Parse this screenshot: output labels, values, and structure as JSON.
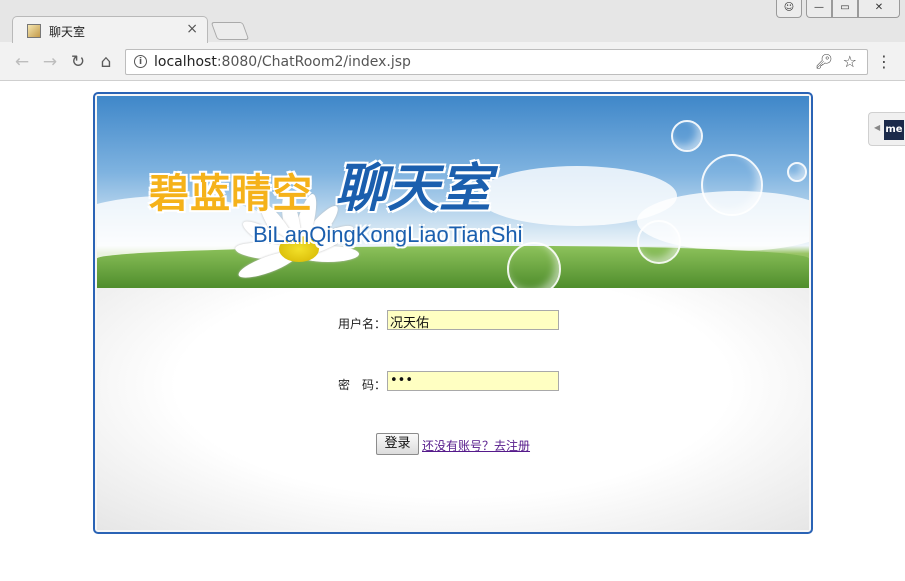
{
  "browser": {
    "tab_title": "聊天室",
    "tab_close": "×",
    "url_host": "localhost",
    "url_path": ":8080/ChatRoom2/index.jsp",
    "icons": {
      "back": "←",
      "forward": "→",
      "reload": "C",
      "home": "⌂",
      "info": "i",
      "key": "⚿",
      "star": "☆",
      "menu": "⋮",
      "user": "👤",
      "min": "—",
      "max": "▭",
      "close": "✕"
    }
  },
  "side_widget": {
    "arrow": "◀",
    "logo": "me"
  },
  "banner": {
    "title_cn": "碧蓝晴空",
    "title_cn2": "聊天室",
    "pinyin": "BiLanQingKongLiaoTianShi"
  },
  "form": {
    "username_label": "用户名：",
    "username_value": "况天佑",
    "password_label": "密　码：",
    "password_value": "•••",
    "login_button": "登录",
    "register_link": "还没有账号？去注册"
  }
}
